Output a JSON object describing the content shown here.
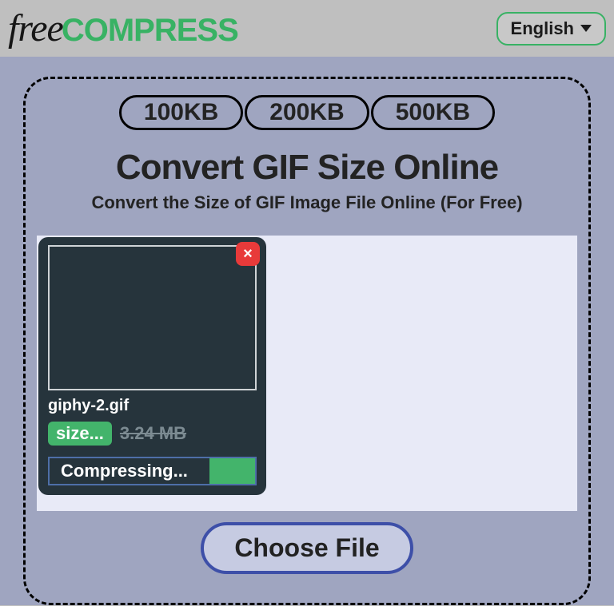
{
  "header": {
    "logo_free": "free",
    "logo_compress": "COMPRESS",
    "language": "English"
  },
  "pills": [
    {
      "label": "100KB"
    },
    {
      "label": "200KB"
    },
    {
      "label": "500KB"
    }
  ],
  "page": {
    "title": "Convert GIF Size Online",
    "subtitle": "Convert the Size of GIF Image File Online (For Free)"
  },
  "file": {
    "name": "giphy-2.gif",
    "size_label": "size...",
    "original_size": "3.24 MB",
    "progress_label": "Compressing...",
    "close": "×"
  },
  "choose_file": "Choose File"
}
